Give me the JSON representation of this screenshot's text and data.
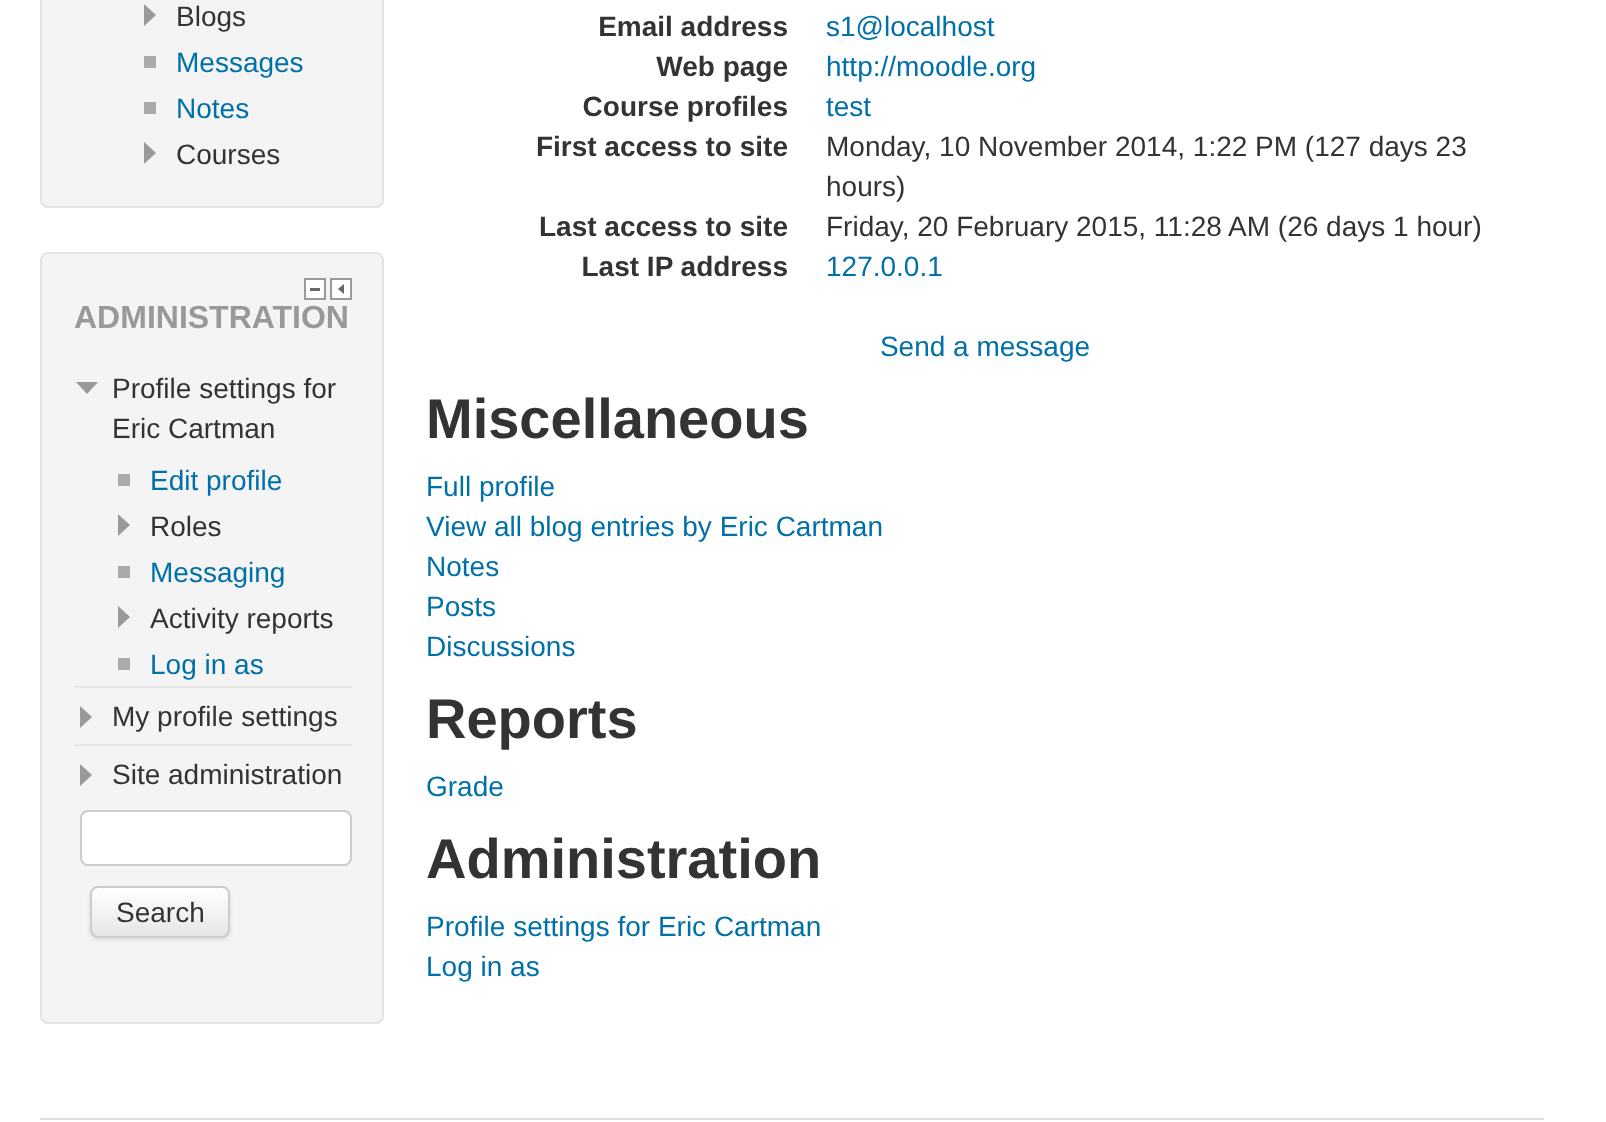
{
  "navigation_block": {
    "items": [
      {
        "kind": "branch",
        "label": "Blogs",
        "expanded": false
      },
      {
        "kind": "link",
        "label": "Messages"
      },
      {
        "kind": "link",
        "label": "Notes"
      },
      {
        "kind": "branch",
        "label": "Courses",
        "expanded": false
      }
    ]
  },
  "administration_block": {
    "title": "ADMINISTRATION",
    "items": [
      {
        "kind": "branch",
        "label": "Profile settings for Eric Cartman",
        "expanded": true,
        "children": [
          {
            "kind": "link",
            "label": "Edit profile"
          },
          {
            "kind": "branch",
            "label": "Roles",
            "expanded": false
          },
          {
            "kind": "link",
            "label": "Messaging"
          },
          {
            "kind": "branch",
            "label": "Activity reports",
            "expanded": false
          },
          {
            "kind": "link",
            "label": "Log in as"
          }
        ]
      },
      {
        "kind": "branch",
        "label": "My profile settings",
        "expanded": false
      },
      {
        "kind": "branch",
        "label": "Site administration",
        "expanded": false
      }
    ],
    "search": {
      "button": "Search"
    }
  },
  "profile_details": [
    {
      "label": "Email address",
      "value": "s1@localhost",
      "kind": "link"
    },
    {
      "label": "Web page",
      "value": "http://moodle.org",
      "kind": "link"
    },
    {
      "label": "Course profiles",
      "value": "test",
      "kind": "link"
    },
    {
      "label": "First access to site",
      "value": "Monday, 10 November 2014, 1:22 PM  (127 days 23 hours)",
      "kind": "text"
    },
    {
      "label": "Last access to site",
      "value": "Friday, 20 February 2015, 11:28 AM  (26 days 1 hour)",
      "kind": "text"
    },
    {
      "label": "Last IP address",
      "value": "127.0.0.1",
      "kind": "link"
    }
  ],
  "send_message": "Send a message",
  "sections": [
    {
      "heading": "Miscellaneous",
      "links": [
        "Full profile",
        "View all blog entries by Eric Cartman",
        "Notes",
        "Posts",
        "Discussions"
      ]
    },
    {
      "heading": "Reports",
      "links": [
        "Grade"
      ]
    },
    {
      "heading": "Administration",
      "links": [
        "Profile settings for Eric Cartman",
        "Log in as"
      ]
    }
  ]
}
